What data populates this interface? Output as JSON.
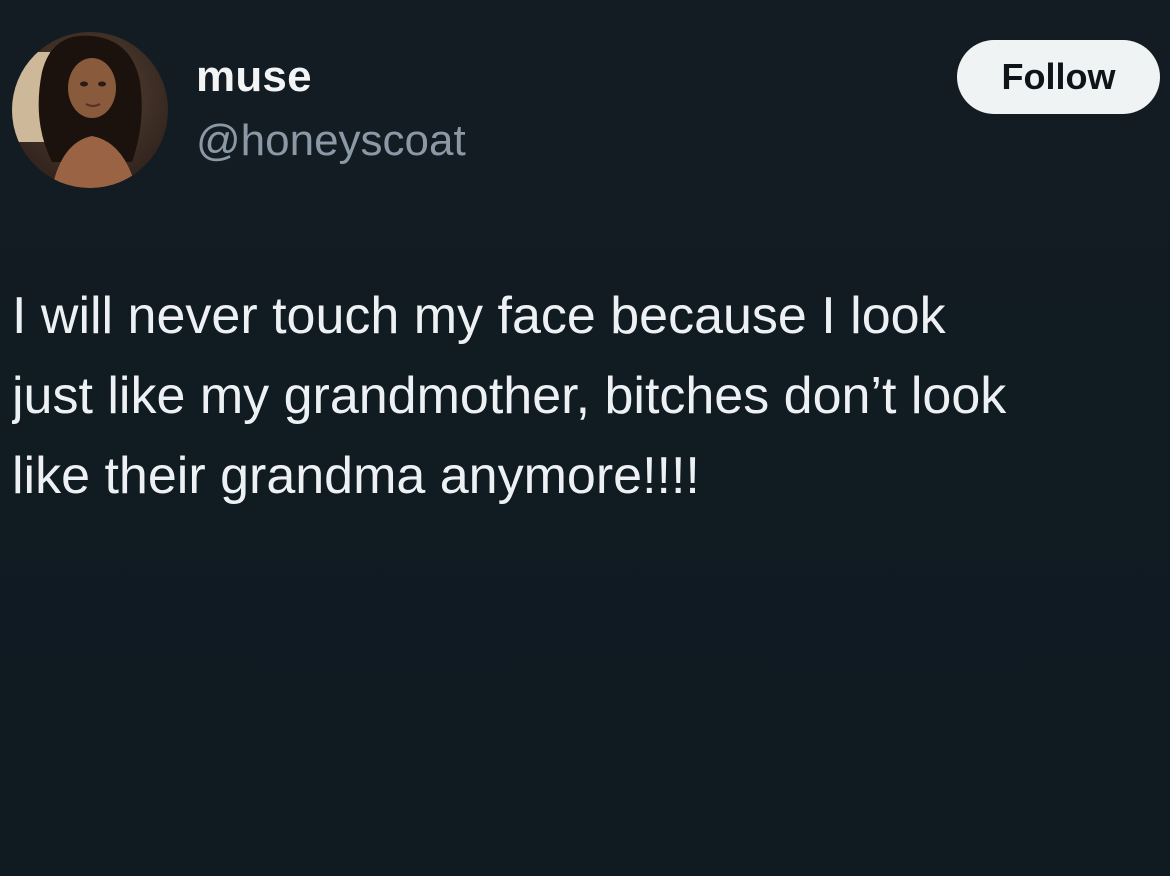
{
  "author": {
    "display_name": "muse",
    "handle": "@honeyscoat",
    "avatar_icon": "profile-photo"
  },
  "actions": {
    "follow_label": "Follow"
  },
  "tweet": {
    "lines": [
      "I will never touch my face because I look",
      "just like my grandmother, bitches don’t look",
      "like their grandma anymore!!!!"
    ]
  },
  "colors": {
    "background": "#111b22",
    "handle": "#8b98a5",
    "button_bg": "#eff3f4",
    "button_text": "#0f1419",
    "text": "#eef1f3"
  }
}
